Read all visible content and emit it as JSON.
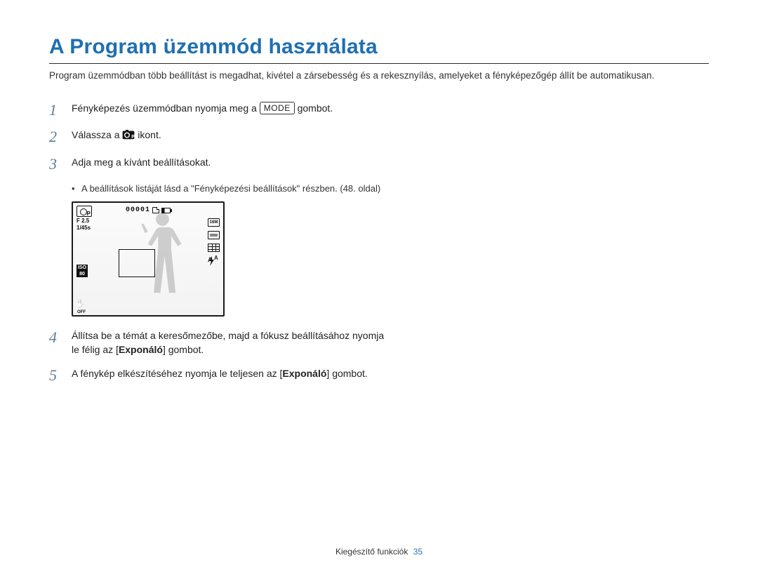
{
  "title": "A Program üzemmód használata",
  "intro": "Program üzemmódban több beállítást is megadhat, kivétel a zársebesség és a rekesznyílás, amelyeket a fényképezőgép állít be automatikusan.",
  "steps": {
    "s1": {
      "num": "1",
      "pre": "Fényképezés üzemmódban nyomja meg a ",
      "key": "MODE",
      "post": " gombot."
    },
    "s2": {
      "num": "2",
      "pre": "Válassza a ",
      "post": " ikont."
    },
    "s3": {
      "num": "3",
      "text": "Adja meg a kívánt beállításokat."
    },
    "s3_sub": "A beállítások listáját lásd a \"Fényképezési beállítások\" részben. (48. oldal)",
    "s4": {
      "num": "4",
      "pre": "Állítsa be a témát a keresőmezőbe, majd a fókusz beállításához nyomja le félig az [",
      "bold": "Exponáló",
      "post": "] gombot."
    },
    "s5": {
      "num": "5",
      "pre": "A fénykép elkészítéséhez nyomja le teljesen az [",
      "bold": "Exponáló",
      "post": "] gombot."
    }
  },
  "lcd": {
    "counter": "00001",
    "f": "F 2.5",
    "shutter": "1/45s",
    "iso_top": "ISO",
    "iso_bot": "80",
    "size": "16M",
    "stab_off": "OFF"
  },
  "footer": {
    "section": "Kiegészítő funkciók",
    "page": "35"
  }
}
